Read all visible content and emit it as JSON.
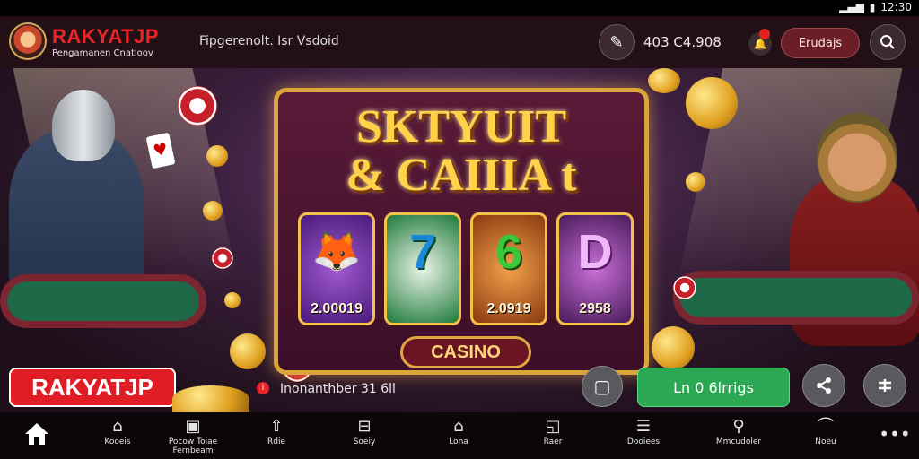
{
  "status": {
    "time": "12:30"
  },
  "header": {
    "brand": "RAKYATJP",
    "subtitle": "Pengamanen Cnatloov",
    "text": "Fipgerenolt. Isr Vsdoid",
    "balance": "403  C4.908",
    "button_label": "Erudajs"
  },
  "banner": {
    "title_line1": "SKTYUIT",
    "title_line2": "& CAIIIA t",
    "reels": [
      {
        "symbol": "fox-icon",
        "value": "2.00019"
      },
      {
        "symbol": "7",
        "value": ""
      },
      {
        "symbol": "6",
        "value": "2.0919"
      },
      {
        "symbol": "D",
        "value": "2958"
      }
    ],
    "casino_label": "CASINO"
  },
  "actionbar": {
    "logo_text": "RAKYATJP",
    "info_text": "Inonanthber 31 6ll",
    "green_button": "Ln 0 6lrrigs"
  },
  "nav": [
    {
      "icon": "home-icon",
      "label": ""
    },
    {
      "icon": "puzzle-icon",
      "label": "Kooeis"
    },
    {
      "icon": "game-icon",
      "label": "Pocow Toiae\nFernbeam"
    },
    {
      "icon": "upload-icon",
      "label": "Rdie"
    },
    {
      "icon": "gift-icon",
      "label": "Soeiy"
    },
    {
      "icon": "house-outline-icon",
      "label": "Lona"
    },
    {
      "icon": "bag-icon",
      "label": "Raer"
    },
    {
      "icon": "list-icon",
      "label": "Dooiees"
    },
    {
      "icon": "search-user-icon",
      "label": "Mmcudoler"
    },
    {
      "icon": "ghost-icon",
      "label": "Noeu"
    },
    {
      "icon": "more-icon",
      "label": ""
    }
  ],
  "colors": {
    "brand_red": "#e8252b",
    "gold": "#ffd24a",
    "green": "#2aa853"
  }
}
